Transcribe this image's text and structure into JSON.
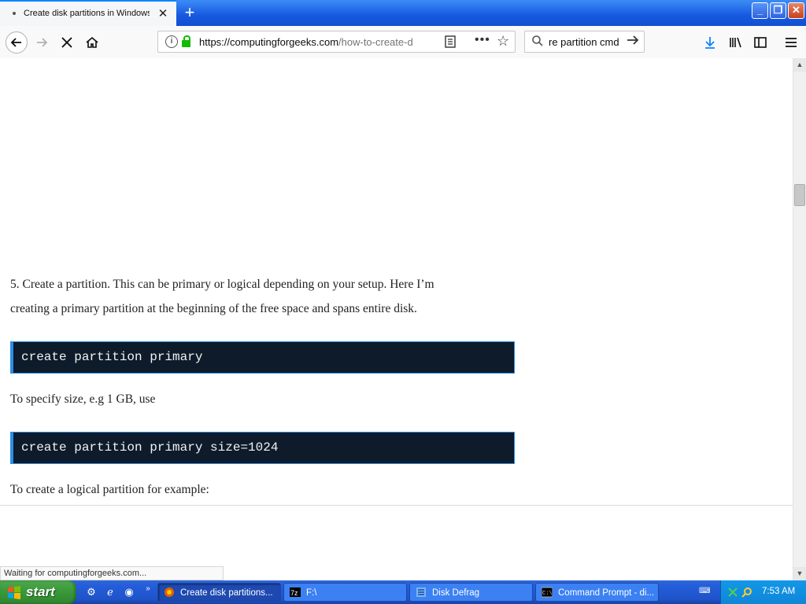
{
  "browser": {
    "tab": {
      "title": "Create disk partitions in Windows u"
    },
    "url": {
      "host": "https://computingforgeeks.com",
      "path": "/how-to-create-d"
    },
    "search": {
      "value": "re partition cmd"
    },
    "status": "Waiting for computingforgeeks.com..."
  },
  "content": {
    "para_step5_line1": "5. Create a partition. This can be primary or logical depending on your setup. Here I’m",
    "para_step5_line2": "creating a primary partition at the beginning of the free space and spans entire disk.",
    "code1": "create partition primary",
    "para_size": "To specify size, e.g 1 GB, use",
    "code2": "create partition primary size=1024",
    "para_logical": "To create a logical partition for example:"
  },
  "taskbar": {
    "start_label": "start",
    "tasks": [
      {
        "label": "Create disk partitions..."
      },
      {
        "label": "F:\\"
      },
      {
        "label": "Disk Defrag"
      },
      {
        "label": "Command Prompt - di..."
      }
    ],
    "clock": "7:53 AM"
  },
  "colors": {
    "accent": "#0a84ff",
    "code_bg": "#0d1b2a",
    "code_border": "#2b8ee6",
    "taskbar_blue": "#245edb",
    "start_green": "#3c9b3c"
  }
}
